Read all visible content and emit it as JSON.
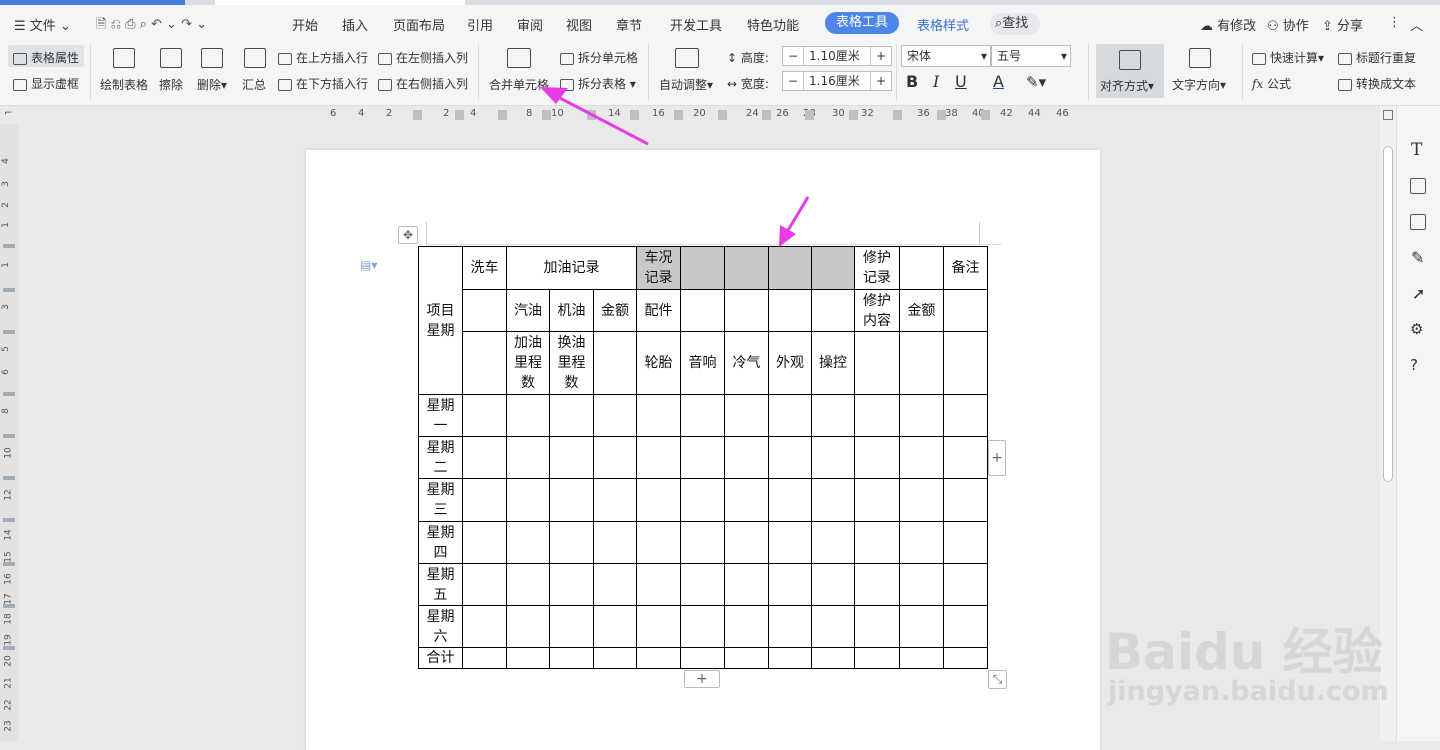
{
  "menubar": {
    "file": "文件",
    "tabs": [
      "开始",
      "插入",
      "页面布局",
      "引用",
      "审阅",
      "视图",
      "章节",
      "开发工具",
      "特色功能"
    ],
    "active_tab": "表格工具",
    "style_tab": "表格样式",
    "search": "查找",
    "modified": "有修改",
    "collab": "协作",
    "share": "分享"
  },
  "ribbon": {
    "table_props": "表格属性",
    "show_gridlines": "显示虚框",
    "draw_table": "绘制表格",
    "erase": "擦除",
    "delete": "删除",
    "summary": "汇总",
    "insert_above": "在上方插入行",
    "insert_below": "在下方插入行",
    "insert_left": "在左侧插入列",
    "insert_right": "在右侧插入列",
    "merge_cells": "合并单元格",
    "split_cells": "拆分单元格",
    "split_table": "拆分表格",
    "auto_fit": "自动调整",
    "height_label": "高度:",
    "height_value": "1.10厘米",
    "width_label": "宽度:",
    "width_value": "1.16厘米",
    "font": "宋体",
    "size": "五号",
    "bold": "B",
    "italic": "I",
    "underline": "U",
    "font_color": "A",
    "align": "对齐方式",
    "text_direction": "文字方向",
    "quick_calc": "快速计算",
    "repeat_header": "标题行重复",
    "formula": "公式",
    "to_text": "转换成文本",
    "minus": "−",
    "plus": "+"
  },
  "ruler": {
    "h": [
      "6",
      "4",
      "2",
      "2",
      "4",
      "8",
      "10",
      "14",
      "16",
      "20",
      "24",
      "26",
      "28",
      "30",
      "32",
      "36",
      "38",
      "40",
      "42",
      "44",
      "46"
    ],
    "v": [
      "4",
      "3",
      "2",
      "1",
      "1",
      "3",
      "5",
      "6",
      "8",
      "10",
      "12",
      "14",
      "15",
      "16",
      "17",
      "18",
      "19",
      "20",
      "21",
      "22",
      "23"
    ]
  },
  "table": {
    "r1": [
      "洗车",
      "加油记录",
      "车况记录",
      "修护记录",
      "备注"
    ],
    "merged": "项目星期",
    "r2": [
      "汽油",
      "机油",
      "金额",
      "配件",
      "修护内容",
      "金额"
    ],
    "r3": [
      "加油里程数",
      "换油里程数",
      "轮胎",
      "音响",
      "冷气",
      "外观",
      "操控"
    ],
    "days": [
      "星期一",
      "星期二",
      "星期三",
      "星期四",
      "星期五",
      "星期六"
    ],
    "total": "合计"
  },
  "watermark": {
    "brand": "Baidu 经验",
    "url": "jingyan.baidu.com"
  }
}
